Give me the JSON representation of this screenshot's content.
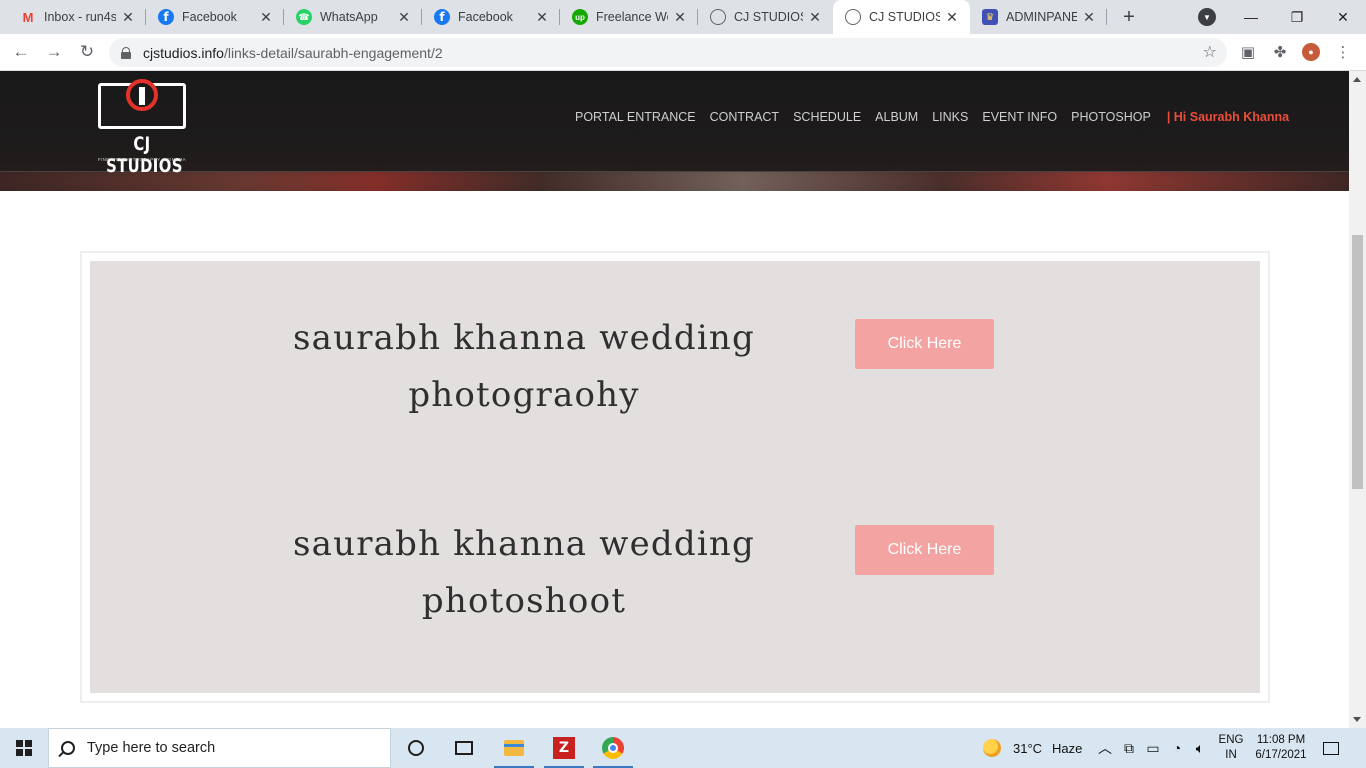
{
  "browser": {
    "tabs": [
      {
        "title": "Inbox - run4s",
        "favicon": "gmail-icon"
      },
      {
        "title": "Facebook",
        "favicon": "facebook-icon"
      },
      {
        "title": "WhatsApp",
        "favicon": "whatsapp-icon"
      },
      {
        "title": "Facebook",
        "favicon": "facebook-icon"
      },
      {
        "title": "Freelance We",
        "favicon": "upwork-icon"
      },
      {
        "title": "CJ STUDIOS |",
        "favicon": "globe-icon"
      },
      {
        "title": "CJ STUDIOS |",
        "favicon": "globe-icon",
        "active": true
      },
      {
        "title": "ADMINPANEL",
        "favicon": "admin-icon"
      }
    ],
    "close_glyph": "✕",
    "new_tab_glyph": "+",
    "url_host": "cjstudios.info",
    "url_path": "/links-detail/saurabh-engagement/2"
  },
  "site": {
    "logo_text": "CJ STUDIOS",
    "logo_subtext": "FINE ART PHOTOGRAPHY & CINEMA",
    "nav": [
      "PORTAL ENTRANCE",
      "CONTRACT",
      "SCHEDULE",
      "ALBUM",
      "LINKS",
      "EVENT INFO",
      "PHOTOSHOP"
    ],
    "user_greeting": "| Hi Saurabh Khanna",
    "accent_color": "#e94e3b",
    "button_color": "#f4a3a3",
    "panel_color": "#e4dfdf"
  },
  "links": [
    {
      "title_line1": "saurabh khanna wedding",
      "title_line2": "photograohy",
      "button_label": "Click Here"
    },
    {
      "title_line1": "saurabh khanna wedding",
      "title_line2": "photoshoot",
      "button_label": "Click Here"
    }
  ],
  "taskbar": {
    "search_placeholder": "Type here to search",
    "weather_temp": "31°C",
    "weather_desc": "Haze",
    "lang_line1": "ENG",
    "lang_line2": "IN",
    "time": "11:08 PM",
    "date": "6/17/2021"
  }
}
